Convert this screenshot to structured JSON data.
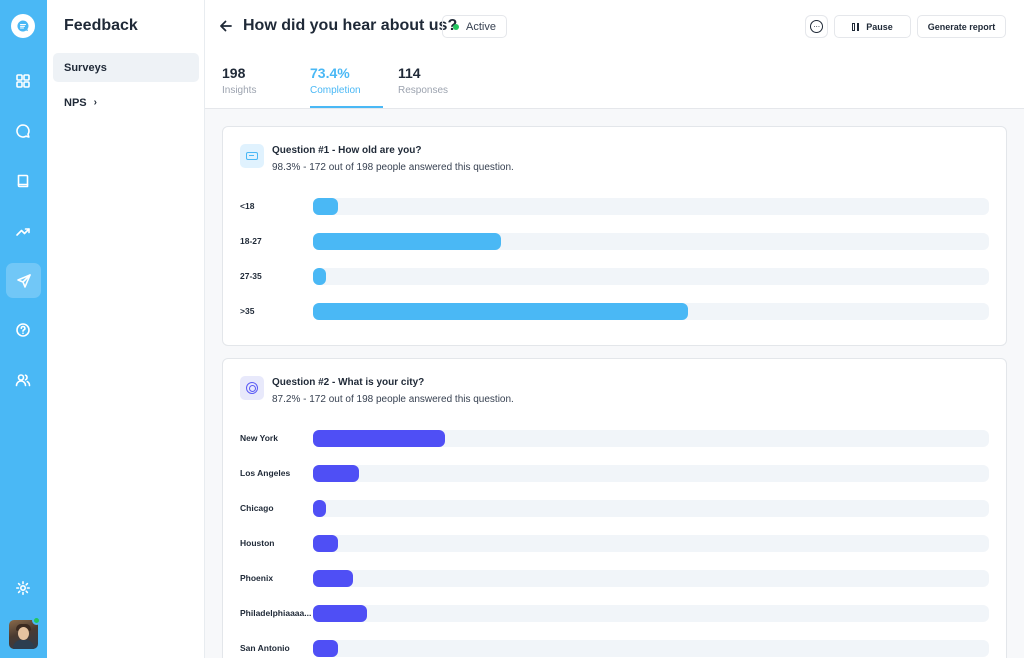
{
  "colors": {
    "accent": "#4ab8f5",
    "series_q1": "#4ab8f5",
    "series_q2": "#4f4ff5",
    "status_active": "#22c55e"
  },
  "rail": {
    "icons": [
      "logo-icon",
      "dashboard-icon",
      "chat-icon",
      "book-icon",
      "trending-icon",
      "send-icon",
      "help-icon",
      "users-icon",
      "settings-icon"
    ],
    "active": "send-icon"
  },
  "sidebar": {
    "title": "Feedback",
    "items": [
      {
        "label": "Surveys",
        "active": true
      },
      {
        "label": "NPS",
        "chevron": "›"
      }
    ]
  },
  "header": {
    "title": "How did you hear about us?",
    "status": "Active",
    "more_icon": "···",
    "pause_label": "Pause",
    "report_label": "Generate report"
  },
  "stats": [
    {
      "value": "198",
      "label": "Insights"
    },
    {
      "value": "73.4%",
      "label": "Completion",
      "active": true
    },
    {
      "value": "114",
      "label": "Responses"
    }
  ],
  "questions": [
    {
      "title": "Question #1 - How old are you?",
      "subtitle": "98.3% - 172 out of 198 people  answered this question.",
      "icon": "input-field-icon",
      "chart_data": {
        "type": "bar",
        "orientation": "horizontal",
        "categories": [
          "<18",
          "18-27",
          "27-35",
          ">35"
        ],
        "values": [
          3.7,
          27.8,
          1.9,
          55.4
        ],
        "value_unit": "percent of track (estimated)",
        "xlim": [
          0,
          100
        ]
      }
    },
    {
      "title": "Question #2 - What is your city?",
      "subtitle": "87.2% - 172 out of 198 people  answered this question.",
      "icon": "radio-target-icon",
      "chart_data": {
        "type": "bar",
        "orientation": "horizontal",
        "categories": [
          "New York",
          "Los Angeles",
          " Chicago",
          "Houston",
          "Phoenix",
          "Philadelphiaaaa...",
          "San Antonio"
        ],
        "values": [
          19.5,
          6.8,
          1.9,
          3.7,
          5.9,
          8.0,
          3.7
        ],
        "value_unit": "percent of track (estimated)",
        "xlim": [
          0,
          100
        ]
      }
    }
  ]
}
